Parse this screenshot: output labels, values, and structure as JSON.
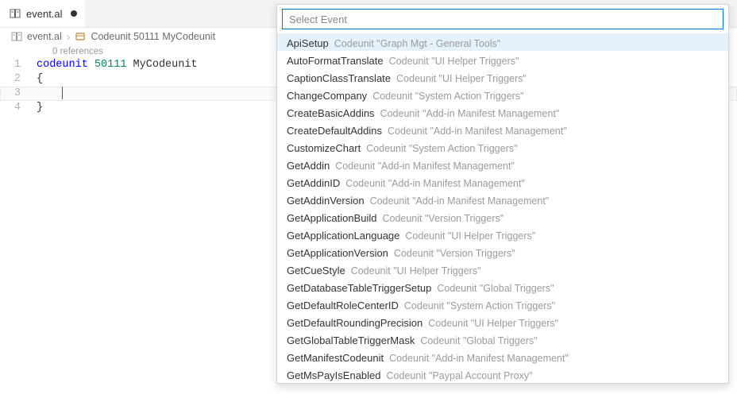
{
  "tab": {
    "filename": "event.al"
  },
  "breadcrumb": {
    "file": "event.al",
    "symbol": "Codeunit 50111 MyCodeunit"
  },
  "editor": {
    "codelens": "0 references",
    "lines": [
      {
        "num": "1",
        "tokens": [
          {
            "cls": "tok-kw",
            "txt": "codeunit"
          },
          {
            "cls": "",
            "txt": " "
          },
          {
            "cls": "tok-num",
            "txt": "50111"
          },
          {
            "cls": "",
            "txt": " "
          },
          {
            "cls": "tok-id",
            "txt": "MyCodeunit"
          }
        ]
      },
      {
        "num": "2",
        "tokens": [
          {
            "cls": "",
            "txt": "{"
          }
        ]
      },
      {
        "num": "3",
        "current": true,
        "tokens": [
          {
            "cls": "",
            "txt": "    "
          }
        ]
      },
      {
        "num": "4",
        "tokens": [
          {
            "cls": "",
            "txt": "}"
          }
        ]
      }
    ]
  },
  "palette": {
    "placeholder": "Select Event",
    "value": "",
    "selectedIndex": 0,
    "items": [
      {
        "name": "ApiSetup",
        "detail": "Codeunit \"Graph Mgt - General Tools\""
      },
      {
        "name": "AutoFormatTranslate",
        "detail": "Codeunit \"UI Helper Triggers\""
      },
      {
        "name": "CaptionClassTranslate",
        "detail": "Codeunit \"UI Helper Triggers\""
      },
      {
        "name": "ChangeCompany",
        "detail": "Codeunit \"System Action Triggers\""
      },
      {
        "name": "CreateBasicAddins",
        "detail": "Codeunit \"Add-in Manifest Management\""
      },
      {
        "name": "CreateDefaultAddins",
        "detail": "Codeunit \"Add-in Manifest Management\""
      },
      {
        "name": "CustomizeChart",
        "detail": "Codeunit \"System Action Triggers\""
      },
      {
        "name": "GetAddin",
        "detail": "Codeunit \"Add-in Manifest Management\""
      },
      {
        "name": "GetAddinID",
        "detail": "Codeunit \"Add-in Manifest Management\""
      },
      {
        "name": "GetAddinVersion",
        "detail": "Codeunit \"Add-in Manifest Management\""
      },
      {
        "name": "GetApplicationBuild",
        "detail": "Codeunit \"Version Triggers\""
      },
      {
        "name": "GetApplicationLanguage",
        "detail": "Codeunit \"UI Helper Triggers\""
      },
      {
        "name": "GetApplicationVersion",
        "detail": "Codeunit \"Version Triggers\""
      },
      {
        "name": "GetCueStyle",
        "detail": "Codeunit \"UI Helper Triggers\""
      },
      {
        "name": "GetDatabaseTableTriggerSetup",
        "detail": "Codeunit \"Global Triggers\""
      },
      {
        "name": "GetDefaultRoleCenterID",
        "detail": "Codeunit \"System Action Triggers\""
      },
      {
        "name": "GetDefaultRoundingPrecision",
        "detail": "Codeunit \"UI Helper Triggers\""
      },
      {
        "name": "GetGlobalTableTriggerMask",
        "detail": "Codeunit \"Global Triggers\""
      },
      {
        "name": "GetManifestCodeunit",
        "detail": "Codeunit \"Add-in Manifest Management\""
      },
      {
        "name": "GetMsPayIsEnabled",
        "detail": "Codeunit \"Paypal Account Proxy\""
      }
    ]
  }
}
